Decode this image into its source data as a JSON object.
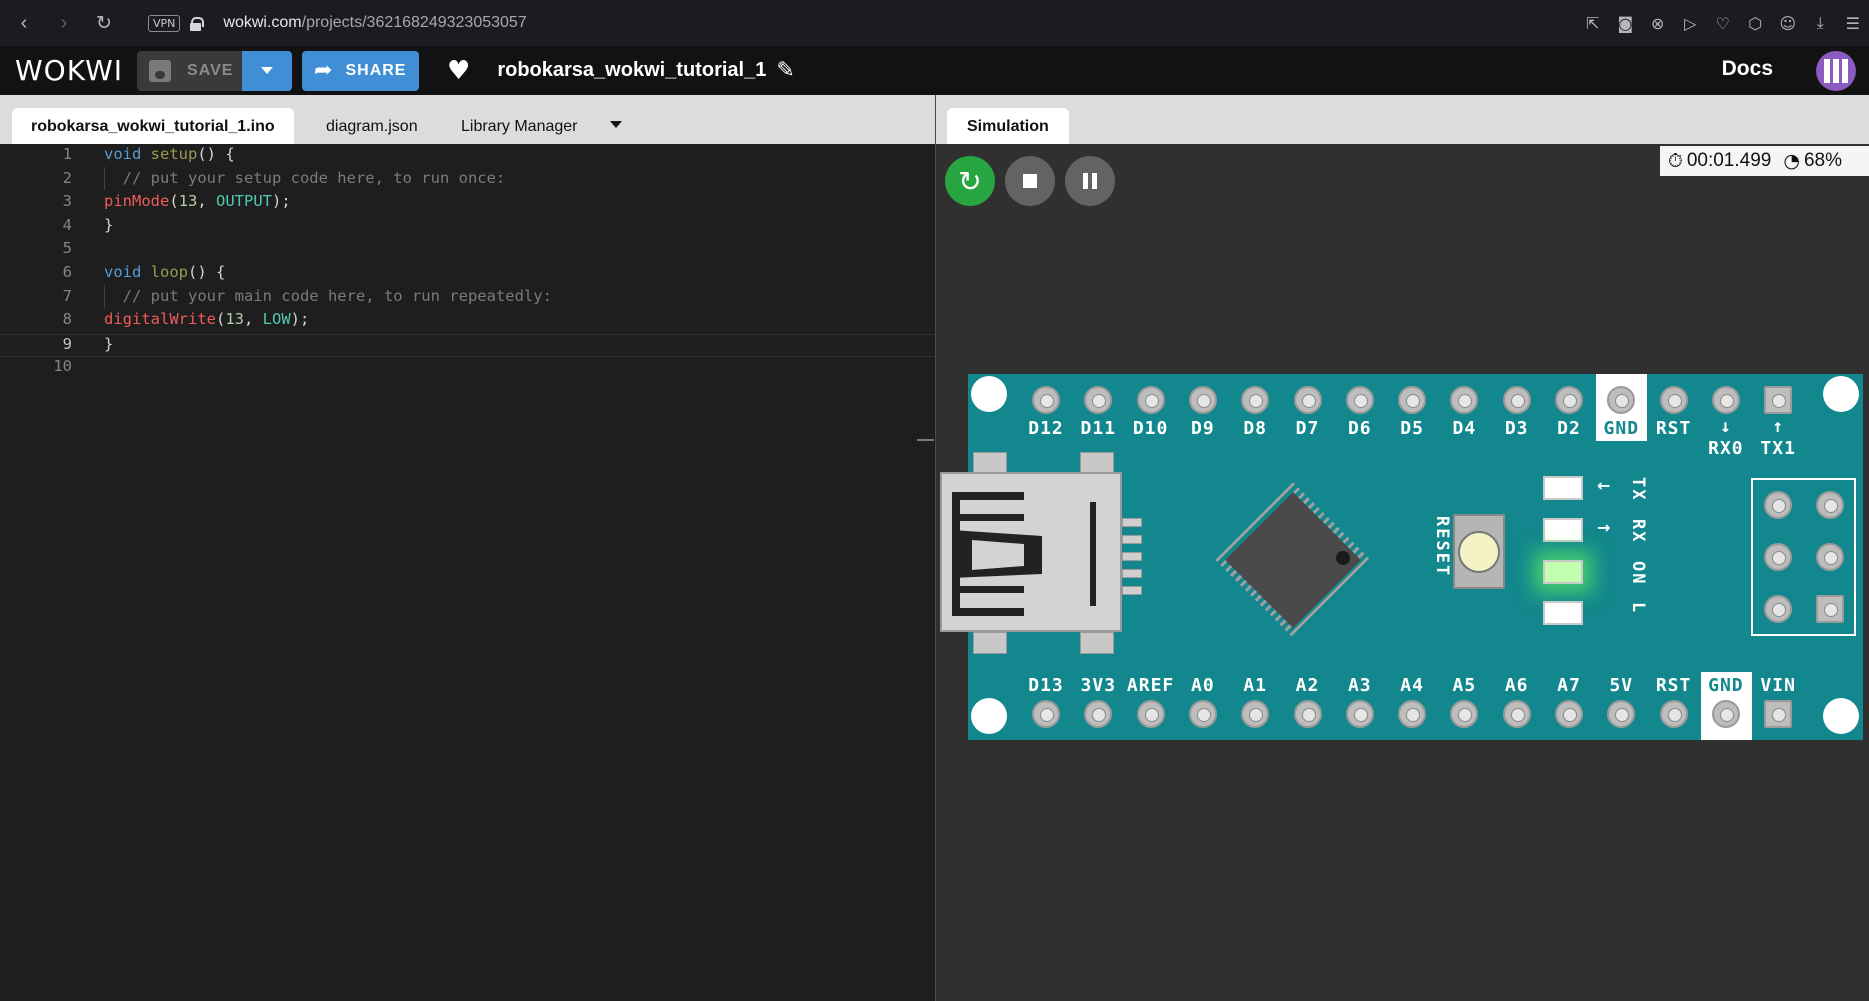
{
  "browser": {
    "url_host": "wokwi.com",
    "url_path": "/projects/362168249323053057",
    "vpn_label": "VPN",
    "nav_icons": [
      "back-icon",
      "forward-icon",
      "reload-icon"
    ],
    "toolbar_icons": [
      "share-page-icon",
      "camera-icon",
      "block-icon",
      "send-icon",
      "heart-outline-icon",
      "box-icon",
      "account-icon",
      "download-icon",
      "settings-sliders-icon"
    ]
  },
  "header": {
    "logo": "WOKWI",
    "save_label": "SAVE",
    "share_label": "SHARE",
    "project_title": "robokarsa_wokwi_tutorial_1",
    "docs_label": "Docs",
    "accent_color": "#3f8ed6"
  },
  "editor": {
    "tabs": [
      {
        "label": "robokarsa_wokwi_tutorial_1.ino",
        "active": true
      },
      {
        "label": "diagram.json",
        "active": false
      },
      {
        "label": "Library Manager",
        "active": false
      }
    ],
    "lines": [
      {
        "n": "1",
        "tokens": [
          {
            "t": "void",
            "c": "kw"
          },
          {
            "t": " ",
            "c": "pn"
          },
          {
            "t": "setup",
            "c": "fn"
          },
          {
            "t": "() {",
            "c": "pn"
          }
        ]
      },
      {
        "n": "2",
        "tokens": [
          {
            "t": "  // put your setup code here, to run once:",
            "c": "cm"
          }
        ]
      },
      {
        "n": "3",
        "tokens": [
          {
            "t": "pinMode",
            "c": "ca"
          },
          {
            "t": "(",
            "c": "pn"
          },
          {
            "t": "13",
            "c": "nm"
          },
          {
            "t": ", ",
            "c": "pn"
          },
          {
            "t": "OUTPUT",
            "c": "co"
          },
          {
            "t": ");",
            "c": "pn"
          }
        ]
      },
      {
        "n": "4",
        "tokens": [
          {
            "t": "}",
            "c": "pn"
          }
        ]
      },
      {
        "n": "5",
        "tokens": []
      },
      {
        "n": "6",
        "tokens": [
          {
            "t": "void",
            "c": "kw"
          },
          {
            "t": " ",
            "c": "pn"
          },
          {
            "t": "loop",
            "c": "fn"
          },
          {
            "t": "() {",
            "c": "pn"
          }
        ]
      },
      {
        "n": "7",
        "tokens": [
          {
            "t": "  // put your main code here, to run repeatedly:",
            "c": "cm"
          }
        ]
      },
      {
        "n": "8",
        "tokens": [
          {
            "t": "digitalWrite",
            "c": "ca"
          },
          {
            "t": "(",
            "c": "pn"
          },
          {
            "t": "13",
            "c": "nm"
          },
          {
            "t": ", ",
            "c": "pn"
          },
          {
            "t": "LOW",
            "c": "co"
          },
          {
            "t": ");",
            "c": "pn"
          }
        ]
      },
      {
        "n": "9",
        "tokens": [
          {
            "t": "}",
            "c": "pn"
          }
        ],
        "current": true
      },
      {
        "n": "10",
        "tokens": []
      }
    ]
  },
  "simulation": {
    "tab_label": "Simulation",
    "elapsed_time": "00:01.499",
    "speed": "68%",
    "board": {
      "top_pins": [
        "D12",
        "D11",
        "D10",
        "D9",
        "D8",
        "D7",
        "D6",
        "D5",
        "D4",
        "D3",
        "D2",
        "GND",
        "RST",
        "RX0",
        "TX1"
      ],
      "bottom_pins": [
        "D13",
        "3V3",
        "AREF",
        "A0",
        "A1",
        "A2",
        "A3",
        "A4",
        "A5",
        "A6",
        "A7",
        "5V",
        "RST",
        "GND",
        "VIN"
      ],
      "reset_label": "RESET",
      "led_labels": [
        "TX",
        "RX",
        "ON",
        "L"
      ],
      "rx_arrow": "↓",
      "tx_arrow": "↑",
      "tx_led_arrow": "←",
      "rx_led_arrow": "→",
      "board_color": "#12878d",
      "power_led_on": true
    }
  }
}
